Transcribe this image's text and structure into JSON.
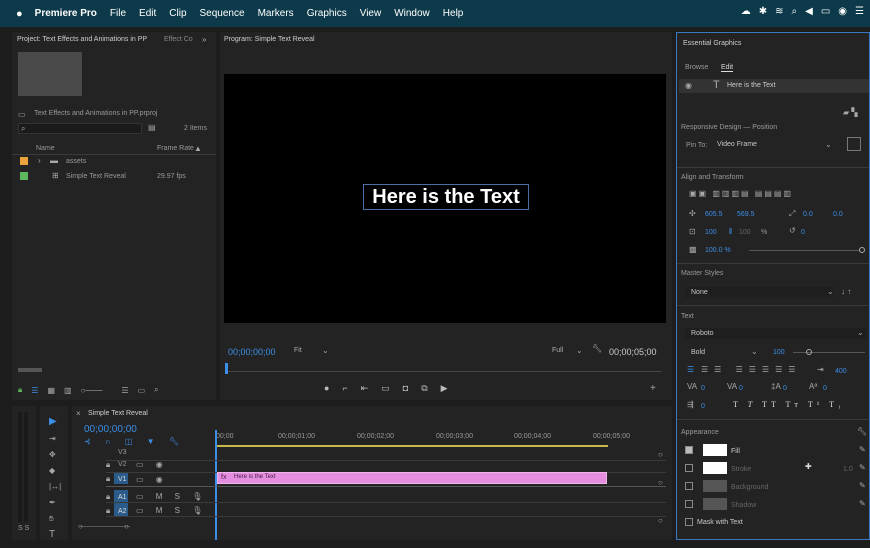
{
  "menubar": {
    "apple": "",
    "app": "Premiere Pro",
    "items": [
      "File",
      "Edit",
      "Clip",
      "Sequence",
      "Markers",
      "Graphics",
      "View",
      "Window",
      "Help"
    ]
  },
  "project": {
    "tab": "Project: Text Effects and Animations in PP",
    "tab2": "Effect Co",
    "file": "Text Effects and Animations in PP.prproj",
    "items_count": "2 Items",
    "col_name": "Name",
    "col_rate": "Frame Rate",
    "rows": [
      {
        "name": "assets",
        "rate": "",
        "color": "#e8a33d"
      },
      {
        "name": "Simple Text Reveal",
        "rate": "29.97 fps",
        "color": "#5cb85c"
      }
    ]
  },
  "program": {
    "tab": "Program: Simple Text Reveal",
    "text": "Here is the Text",
    "timecode": "00;00;00;00",
    "fit": "Fit",
    "quality": "Full",
    "duration": "00;00;05;00"
  },
  "timeline": {
    "tab": "Simple Text Reveal",
    "timecode": "00;00;00;00",
    "ruler": [
      "00;00",
      "00;00;01;00",
      "00;00;02;00",
      "00;00;03;00",
      "00;00;04;00",
      "00;00;05;00"
    ],
    "tracks": [
      "V3",
      "V2",
      "V1",
      "A1",
      "A2"
    ],
    "clip": "Here is the Text"
  },
  "eg": {
    "title": "Essential Graphics",
    "tab_browse": "Browse",
    "tab_edit": "Edit",
    "layer": "Here is the Text",
    "responsive": "Responsive Design — Position",
    "pin_label": "Pin To:",
    "pin_value": "Video Frame",
    "align": "Align and Transform",
    "pos_x": "605.5",
    "pos_y": "569.5",
    "rot": "0.0",
    "rot2": "0.0",
    "scale": "100",
    "scale2": "100",
    "pct": "%",
    "angle": "0",
    "opacity": "100.0 %",
    "master": "Master Styles",
    "master_value": "None",
    "text_section": "Text",
    "font": "Roboto",
    "weight": "Bold",
    "size": "100",
    "tracking": "400",
    "kern": "0",
    "lead": "0",
    "base": "0",
    "tsume": "0",
    "indent": "0",
    "appearance": "Appearance",
    "fill": "Fill",
    "stroke": "Stroke",
    "stroke_w": "1.0",
    "background": "Background",
    "shadow": "Shadow",
    "mask": "Mask with Text"
  }
}
